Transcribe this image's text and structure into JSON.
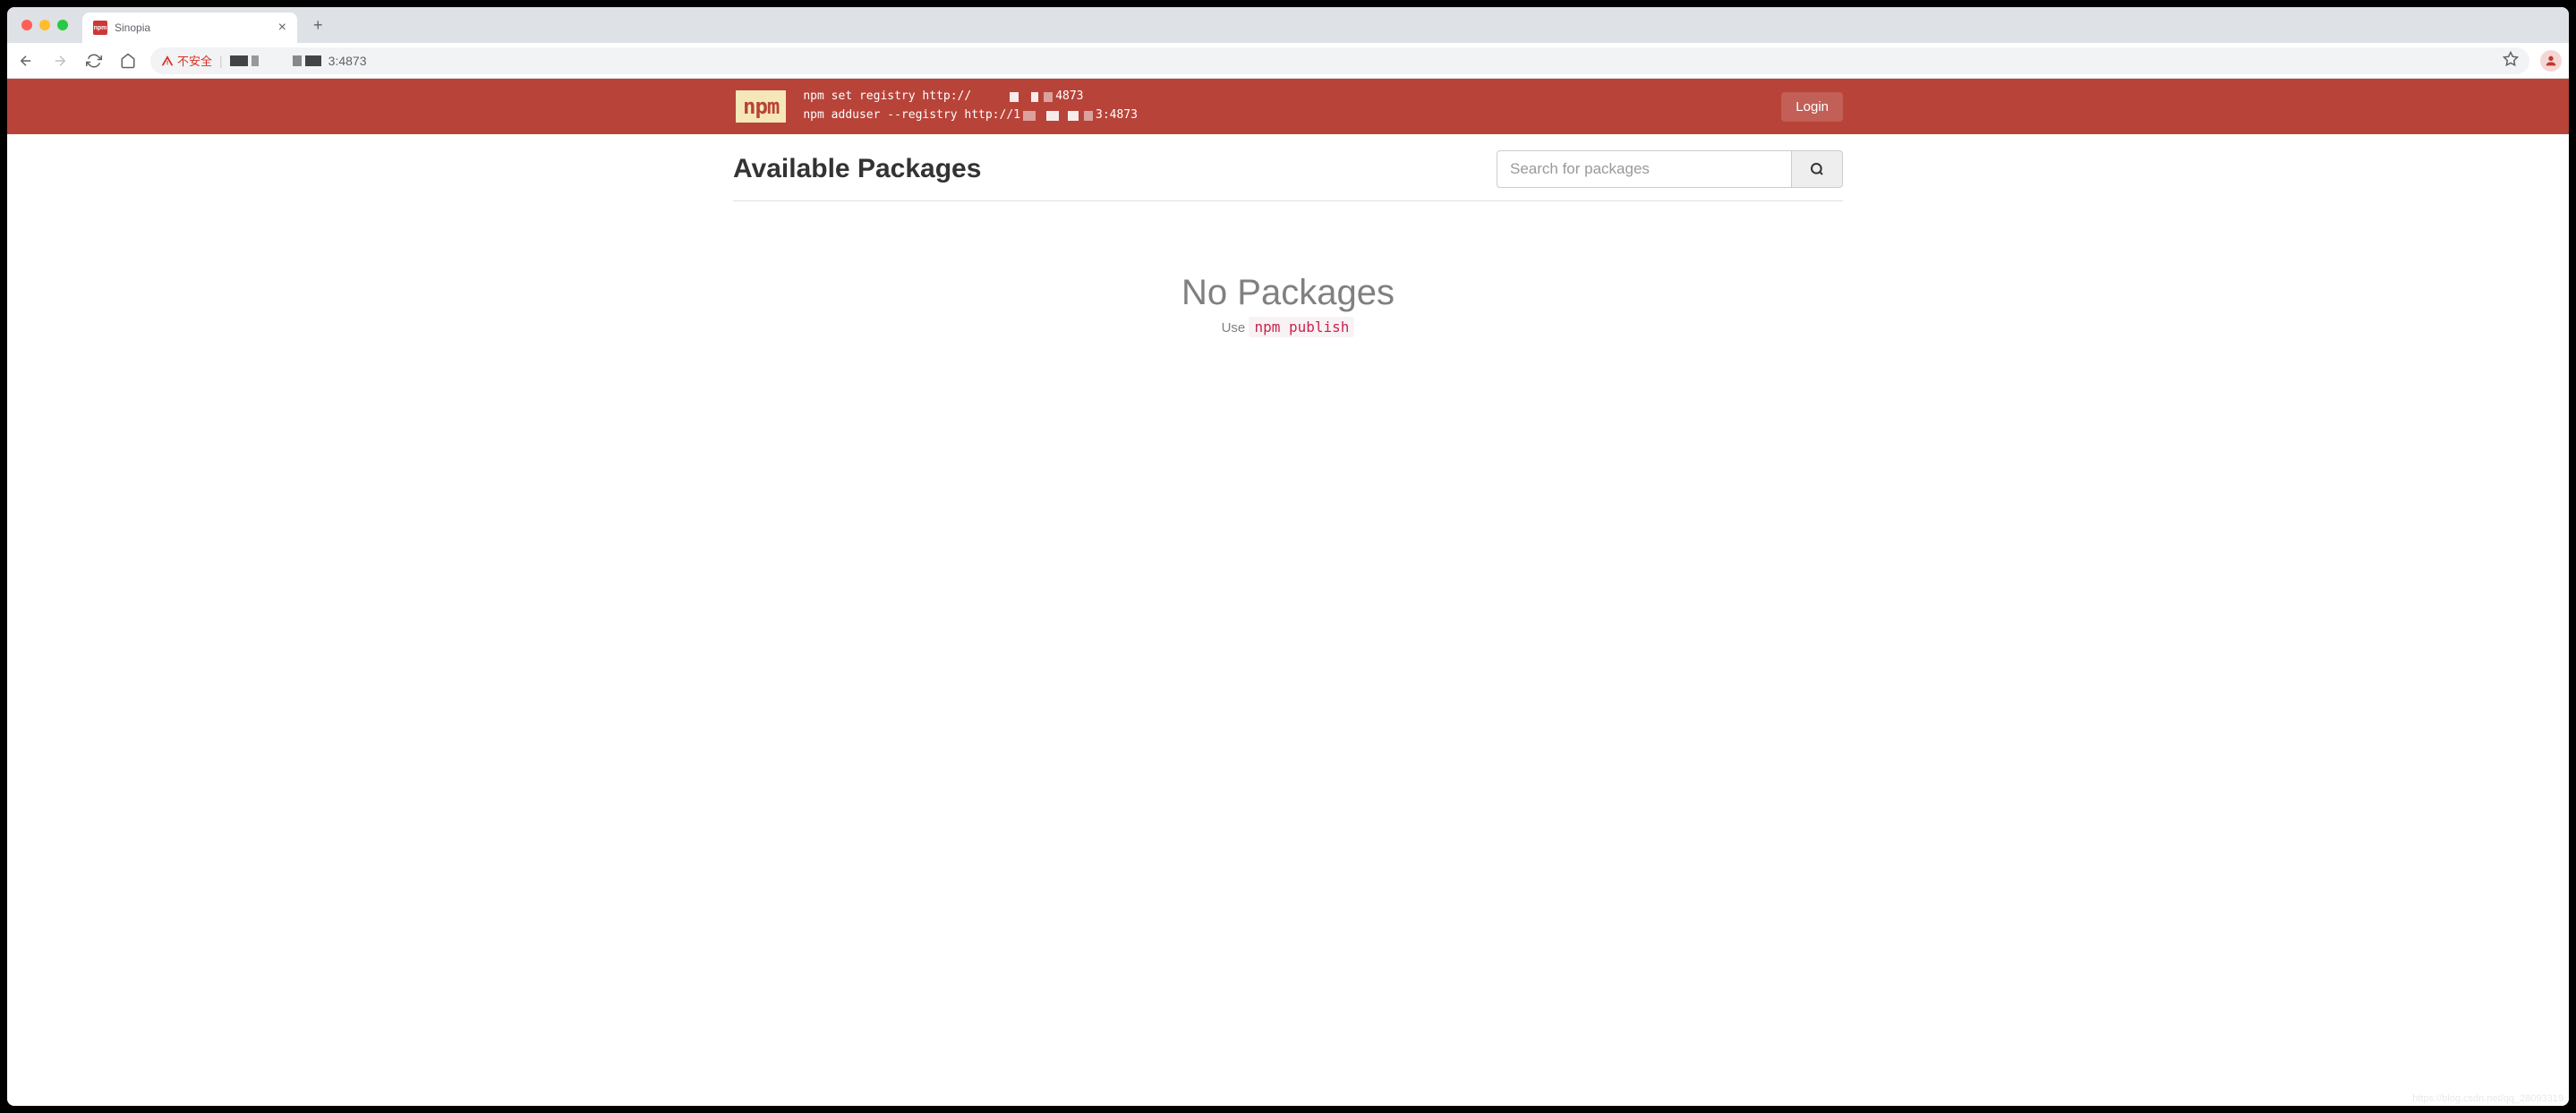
{
  "browser": {
    "tab": {
      "title": "Sinopia",
      "favicon_text": "npm"
    },
    "address": {
      "insecure_label": "不安全",
      "url_visible_suffix": "3:4873"
    }
  },
  "header": {
    "logo_text": "npm",
    "command_line_1_prefix": "npm set registry http://",
    "command_line_1_suffix": "4873",
    "command_line_2_prefix": "npm adduser --registry http://1",
    "command_line_2_suffix": "3:4873",
    "login_button": "Login"
  },
  "main": {
    "title": "Available Packages",
    "search_placeholder": "Search for packages"
  },
  "empty": {
    "heading": "No Packages",
    "subtext_prefix": "Use ",
    "subtext_code": "npm publish"
  },
  "watermark": "https://blog.csdn.net/qq_28093319"
}
